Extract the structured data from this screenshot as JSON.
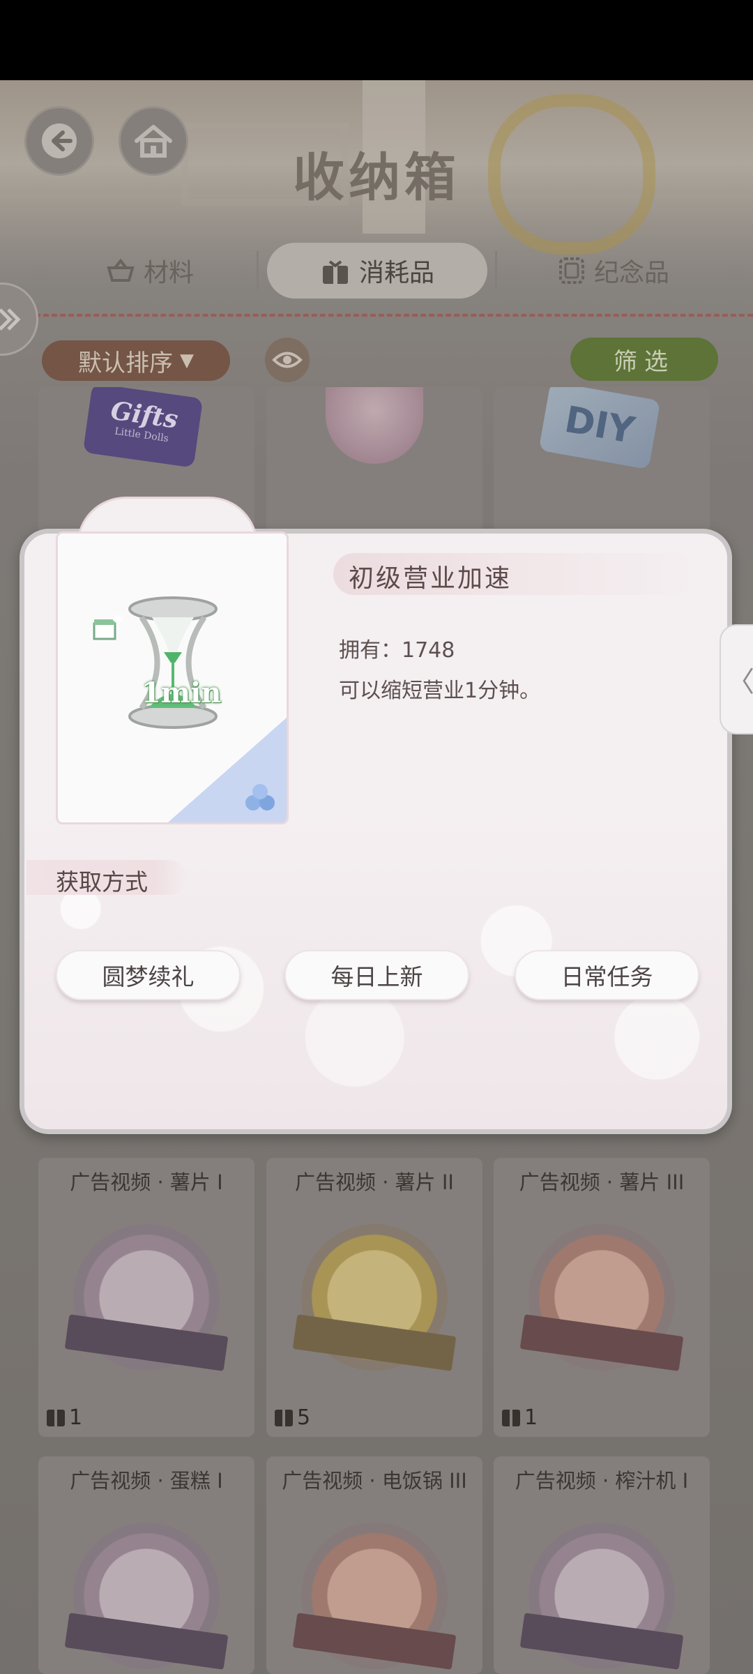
{
  "header": {
    "title": "收纳箱"
  },
  "tabs": [
    {
      "label": "材料",
      "icon": "basket-icon",
      "active": false
    },
    {
      "label": "消耗品",
      "icon": "gift-box-icon",
      "active": true
    },
    {
      "label": "纪念品",
      "icon": "frame-icon",
      "active": false
    }
  ],
  "toolbar": {
    "sort_label": "默认排序",
    "filter_label": "筛选"
  },
  "top_row_labels": {
    "card1": "Gifts",
    "card1_sub": "Little Dolls",
    "card3": "DIY"
  },
  "modal": {
    "item_name": "初级营业加速",
    "badge_text": "1min",
    "owned_text": "拥有：1748",
    "description": "可以缩短营业1分钟。",
    "section_title": "获取方式",
    "sources": [
      "圆梦续礼",
      "每日上新",
      "日常任务"
    ]
  },
  "grid": {
    "row1": [
      {
        "label": "广告视频 · 薯片 I",
        "count": "1",
        "tone": "pink"
      },
      {
        "label": "广告视频 · 薯片 II",
        "count": "5",
        "tone": "gold"
      },
      {
        "label": "广告视频 · 薯片 III",
        "count": "1",
        "tone": "red"
      }
    ],
    "row2": [
      {
        "label": "广告视频 · 蛋糕 I",
        "tone": "pink"
      },
      {
        "label": "广告视频 · 电饭锅 III",
        "tone": "red"
      },
      {
        "label": "广告视频 · 榨汁机 I",
        "tone": "pink"
      }
    ]
  },
  "colors": {
    "accent_green": "#627a3a",
    "sort_brown": "#7b5a49",
    "dash_red": "#a2625c"
  }
}
